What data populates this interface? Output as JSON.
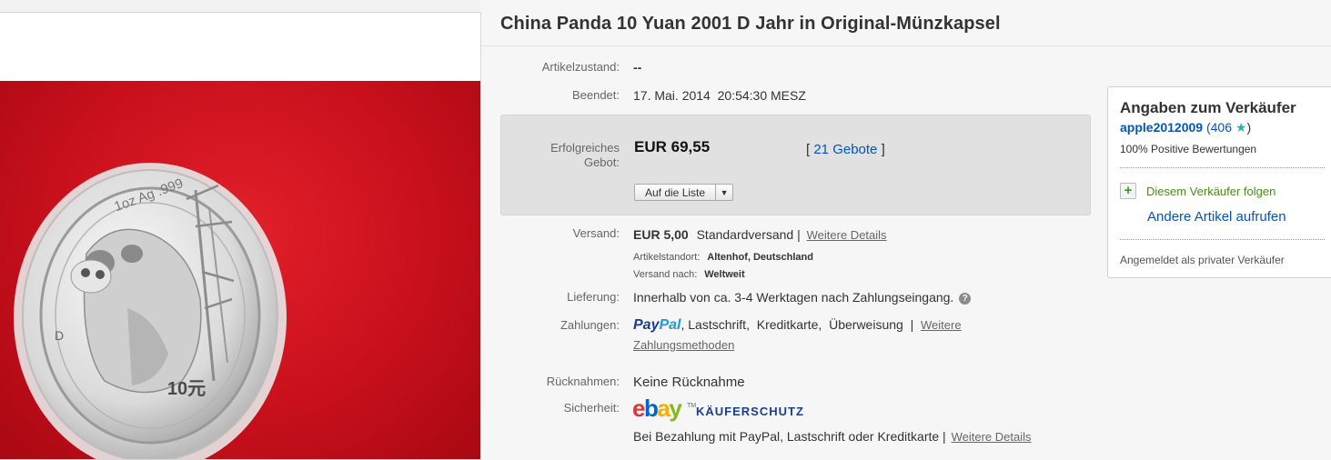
{
  "title": "China Panda 10 Yuan 2001 D Jahr in Original-Münzkapsel",
  "image": {
    "coin_rim_text": "1oz Ag .999",
    "coin_mint": "D",
    "coin_value": "10元"
  },
  "details": {
    "condition_label": "Artikelzustand:",
    "condition_value": "--",
    "ended_label": "Beendet:",
    "ended_value": "17. Mai. 2014  20:54:30 MESZ",
    "bid_label_1": "Erfolgreiches",
    "bid_label_2": "Gebot:",
    "bid_price": "EUR 69,55",
    "bids_open": "[",
    "bids_count": "21 Gebote",
    "bids_close": "]",
    "watch_button": "Auf die Liste",
    "shipping_label": "Versand:",
    "shipping_price": "EUR 5,00",
    "shipping_type": "Standardversand |",
    "shipping_more": "Weitere Details",
    "location_label": "Artikelstandort:",
    "location_value": "Altenhof, Deutschland",
    "ships_to_label": "Versand nach:",
    "ships_to_value": "Weltweit",
    "delivery_label": "Lieferung:",
    "delivery_value": "Innerhalb von ca. 3-4 Werktagen nach Zahlungseingang.",
    "payments_label": "Zahlungen:",
    "paypal_1": "Pay",
    "paypal_2": "Pal",
    "payments_value": ", Lastschrift,  Kreditkarte,  Überweisung  |",
    "payments_more_1": "Weitere",
    "payments_more_2": "Zahlungsmethoden",
    "returns_label": "Rücknahmen:",
    "returns_value": "Keine Rücknahme",
    "security_label": "Sicherheit:",
    "ebay_e": "e",
    "ebay_b": "b",
    "ebay_a": "a",
    "ebay_y": "y",
    "ebay_tm": "TM",
    "kaeuferschutz": "KÄUFERSCHUTZ",
    "protection_text": "Bei Bezahlung mit PayPal, Lastschrift oder Kreditkarte |",
    "protection_more": "Weitere Details"
  },
  "seller": {
    "heading": "Angaben zum Verkäufer",
    "username": "apple2012009",
    "score_open": " (406 ",
    "score_close": ")",
    "star_color": "#21b8a7",
    "positive": "100% Positive Bewertungen",
    "follow": "Diesem Verkäufer folgen",
    "other_items": "Andere Artikel aufrufen",
    "private": "Angemeldet als privater Verkäufer"
  },
  "colors": {
    "link": "#0654ba",
    "follow_green": "#4a8b1f",
    "background_red": "#c8101c"
  }
}
